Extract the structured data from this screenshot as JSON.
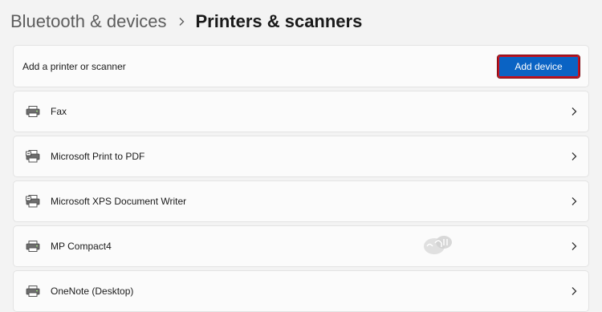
{
  "breadcrumb": {
    "parent": "Bluetooth & devices",
    "current": "Printers & scanners"
  },
  "add_section": {
    "label": "Add a printer or scanner",
    "button": "Add device"
  },
  "devices": [
    {
      "name": "Fax",
      "icon": "printer-icon"
    },
    {
      "name": "Microsoft Print to PDF",
      "icon": "virtual-printer-icon"
    },
    {
      "name": "Microsoft XPS Document Writer",
      "icon": "virtual-printer-icon"
    },
    {
      "name": "MP Compact4",
      "icon": "printer-icon"
    },
    {
      "name": "OneNote (Desktop)",
      "icon": "printer-icon"
    }
  ],
  "colors": {
    "accent": "#0a63c4",
    "highlight_border": "#c1121f",
    "background": "#f3f3f3",
    "card": "#fbfbfb"
  }
}
